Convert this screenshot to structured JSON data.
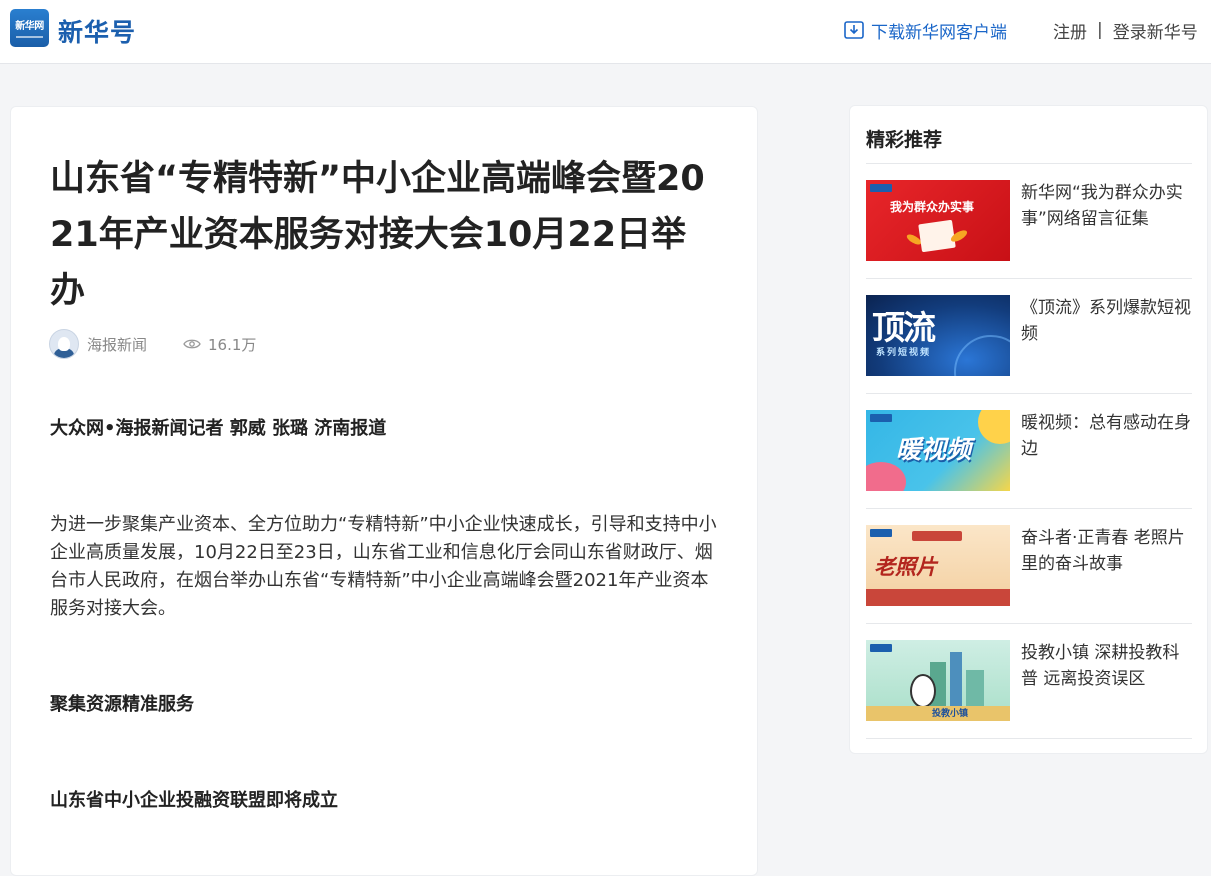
{
  "header": {
    "logo_mark": "新华网",
    "brand": "新华号",
    "download_label": "下载新华网客户端",
    "register_label": "注册",
    "separator": "|",
    "login_label": "登录新华号"
  },
  "article": {
    "title": "山东省“专精特新”中小企业高端峰会暨2021年产业资本服务对接大会10月22日举办",
    "author": "海报新闻",
    "views": "16.1万",
    "byline": "大众网•海报新闻记者 郭威 张璐 济南报道",
    "paragraph1": "为进一步聚集产业资本、全方位助力“专精特新”中小企业快速成长，引导和支持中小企业高质量发展，10月22日至23日，山东省工业和信息化厅会同山东省财政厅、烟台市人民政府，在烟台举办山东省“专精特新”中小企业高端峰会暨2021年产业资本服务对接大会。",
    "subheading1": "聚集资源精准服务",
    "subheading2": "山东省中小企业投融资联盟即将成立"
  },
  "sidebar": {
    "title": "精彩推荐",
    "items": [
      {
        "text": "新华网“我为群众办实事”网络留言征集",
        "thumb_text": "我为群众办实事"
      },
      {
        "text": "《顶流》系列爆款短视频",
        "thumb_text": "顶流",
        "thumb_sub": "系列短视频"
      },
      {
        "text": "暖视频：总有感动在身边",
        "thumb_text": "暖视频"
      },
      {
        "text": "奋斗者·正青春 老照片里的奋斗故事",
        "thumb_text": "老照片"
      },
      {
        "text": "投教小镇 深耕投教科普 远离投资误区",
        "thumb_text": "投教小镇"
      }
    ]
  },
  "colors": {
    "brand_blue": "#1b5fae",
    "link_blue": "#1a66c8"
  }
}
